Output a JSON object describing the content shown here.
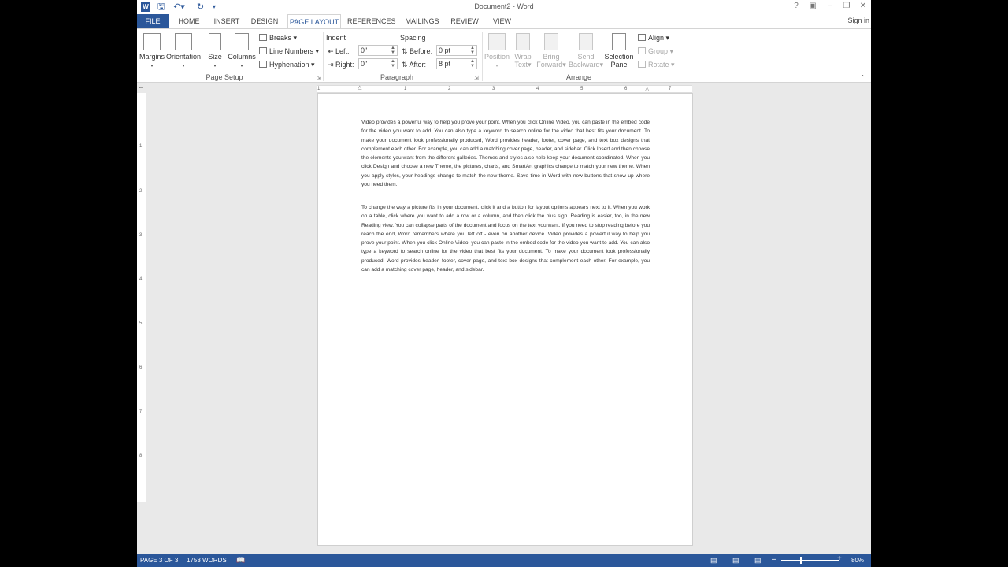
{
  "window": {
    "title": "Document2 - Word",
    "signin": "Sign in"
  },
  "tabs": [
    "FILE",
    "HOME",
    "INSERT",
    "DESIGN",
    "PAGE LAYOUT",
    "REFERENCES",
    "MAILINGS",
    "REVIEW",
    "VIEW"
  ],
  "ribbon": {
    "page_setup": {
      "label": "Page Setup",
      "margins": "Margins",
      "orientation": "Orientation",
      "size": "Size",
      "columns": "Columns",
      "breaks": "Breaks",
      "line_numbers": "Line Numbers",
      "hyphenation": "Hyphenation"
    },
    "paragraph": {
      "label": "Paragraph",
      "indent_heading": "Indent",
      "spacing_heading": "Spacing",
      "left_label": "Left:",
      "left_value": "0\"",
      "right_label": "Right:",
      "right_value": "0\"",
      "before_label": "Before:",
      "before_value": "0 pt",
      "after_label": "After:",
      "after_value": "8 pt"
    },
    "arrange": {
      "label": "Arrange",
      "position": "Position",
      "wrap_text_1": "Wrap",
      "wrap_text_2": "Text",
      "bring_forward_1": "Bring",
      "bring_forward_2": "Forward",
      "send_backward_1": "Send",
      "send_backward_2": "Backward",
      "selection_pane_1": "Selection",
      "selection_pane_2": "Pane",
      "align": "Align",
      "group": "Group",
      "rotate": "Rotate"
    }
  },
  "document": {
    "paragraph1": "Video provides a powerful way to help you prove your point. When you click Online Video, you can paste in the embed code for the video you want to add. You can also type a keyword to search online for the video that best fits your document. To make your document look professionally produced, Word provides header, footer, cover page, and text box designs that complement each other. For example, you can add a matching cover page, header, and sidebar. Click Insert and then choose the elements you want from the different galleries. Themes and styles also help keep your document coordinated. When you click Design and choose a new Theme, the pictures, charts, and SmartArt graphics change to match your new theme. When you apply styles, your headings change to match the new theme. Save time in Word with new buttons that show up where you need them.",
    "paragraph2": "To change the way a picture fits in your document, click it and a button for layout options appears next to it. When you work on a table, click where you want to add a row or a column, and then click the plus sign. Reading is easier, too, in the new Reading view. You can collapse parts of the document and focus on the text you want. If you need to stop reading before you reach the end, Word remembers where you left off - even on another device. Video provides a powerful way to help you prove your point. When you click Online Video, you can paste in the embed code for the video you want to add. You can also type a keyword to search online for the video that best fits your document. To make your document look professionally produced, Word provides header, footer, cover page, and text box designs that complement each other. For example, you can add a matching cover page, header, and sidebar."
  },
  "status": {
    "page": "PAGE 3 OF 3",
    "words": "1753 WORDS",
    "zoom": "80%"
  }
}
